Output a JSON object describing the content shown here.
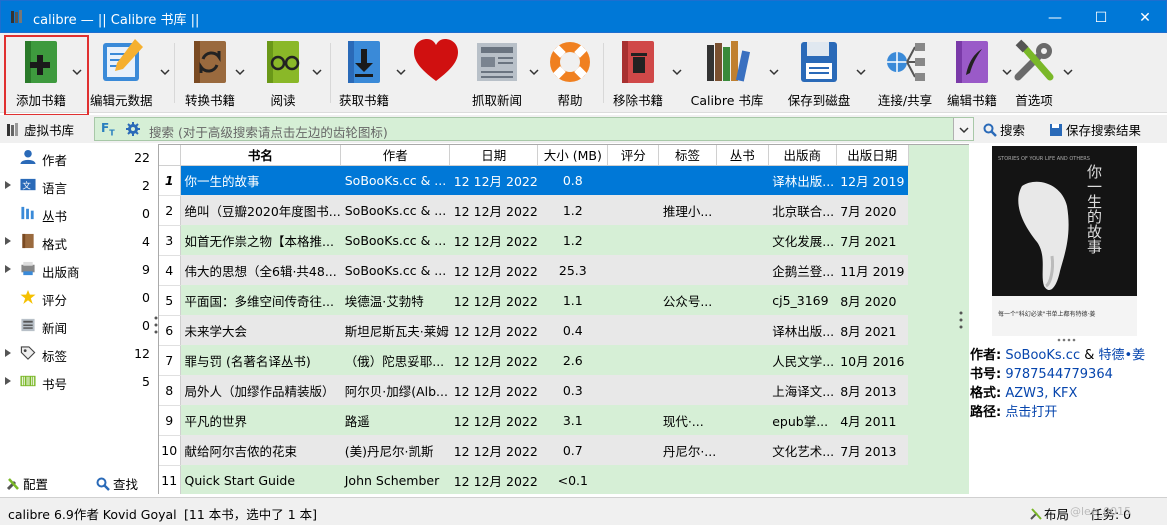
{
  "window": {
    "title": "calibre — || Calibre 书库 ||",
    "minimize": "—",
    "maximize": "☐",
    "close": "✕"
  },
  "toolbar": {
    "items": [
      {
        "label": "添加书籍",
        "icon": "add-book-icon"
      },
      {
        "label": "编辑元数据",
        "icon": "edit-metadata-icon"
      },
      {
        "label": "转换书籍",
        "icon": "convert-books-icon"
      },
      {
        "label": "阅读",
        "icon": "read-book-icon"
      },
      {
        "label": "获取书籍",
        "icon": "get-books-icon"
      },
      {
        "label": "",
        "icon": "heart-icon"
      },
      {
        "label": "抓取新闻",
        "icon": "fetch-news-icon"
      },
      {
        "label": "帮助",
        "icon": "help-lifebuoy-icon"
      },
      {
        "label": "移除书籍",
        "icon": "remove-books-icon"
      },
      {
        "label": "Calibre 书库",
        "icon": "library-icon"
      },
      {
        "label": "保存到磁盘",
        "icon": "save-disk-icon"
      },
      {
        "label": "连接/共享",
        "icon": "connect-share-icon"
      },
      {
        "label": "编辑书籍",
        "icon": "edit-book-icon"
      },
      {
        "label": "首选项",
        "icon": "preferences-icon"
      }
    ]
  },
  "search": {
    "virtual_library": "虚拟书库",
    "ft": "F",
    "placeholder": "搜索 (对于高级搜索请点击左边的齿轮图标)",
    "search_button": "搜索",
    "save_search_button": "保存搜索结果"
  },
  "tag_browser": {
    "items": [
      {
        "label": "作者",
        "count": "22",
        "icon": "author-icon",
        "expandable": false
      },
      {
        "label": "语言",
        "count": "2",
        "icon": "language-icon",
        "expandable": true
      },
      {
        "label": "丛书",
        "count": "0",
        "icon": "series-icon",
        "expandable": false
      },
      {
        "label": "格式",
        "count": "4",
        "icon": "format-icon",
        "expandable": true
      },
      {
        "label": "出版商",
        "count": "9",
        "icon": "publisher-icon",
        "expandable": true
      },
      {
        "label": "评分",
        "count": "0",
        "icon": "rating-star-icon",
        "expandable": false
      },
      {
        "label": "新闻",
        "count": "0",
        "icon": "news-icon",
        "expandable": false
      },
      {
        "label": "标签",
        "count": "12",
        "icon": "tag-icon",
        "expandable": true
      },
      {
        "label": "书号",
        "count": "5",
        "icon": "isbn-barcode-icon",
        "expandable": true
      }
    ],
    "configure": "配置",
    "find": "查找"
  },
  "table": {
    "columns": [
      "书名",
      "作者",
      "日期",
      "大小 (MB)",
      "评分",
      "标签",
      "丛书",
      "出版商",
      "出版日期"
    ],
    "rows": [
      {
        "num": "1",
        "title": "你一生的故事",
        "author": "SoBooKs.cc & ...",
        "date": "12 12月 2022",
        "size": "0.8",
        "rating": "",
        "tags": "",
        "series": "",
        "publisher": "译林出版...",
        "pubdate": "12月 2019"
      },
      {
        "num": "2",
        "title": "绝叫（豆瓣2020年度图书...",
        "author": "SoBooKs.cc & ...",
        "date": "12 12月 2022",
        "size": "1.2",
        "rating": "",
        "tags": "推理小...",
        "series": "",
        "publisher": "北京联合...",
        "pubdate": "7月 2020"
      },
      {
        "num": "3",
        "title": "如首无作祟之物【本格推...",
        "author": "SoBooKs.cc & ...",
        "date": "12 12月 2022",
        "size": "1.2",
        "rating": "",
        "tags": "",
        "series": "",
        "publisher": "文化发展...",
        "pubdate": "7月 2021"
      },
      {
        "num": "4",
        "title": "伟大的思想（全6辑·共48...",
        "author": "SoBooKs.cc & ...",
        "date": "12 12月 2022",
        "size": "25.3",
        "rating": "",
        "tags": "",
        "series": "",
        "publisher": "企鹅兰登...",
        "pubdate": "11月 2019"
      },
      {
        "num": "5",
        "title": "平面国：多维空间传奇往...",
        "author": "埃德温·艾勃特",
        "date": "12 12月 2022",
        "size": "1.1",
        "rating": "",
        "tags": "公众号...",
        "series": "",
        "publisher": "cj5_3169",
        "pubdate": "8月 2020"
      },
      {
        "num": "6",
        "title": "未来学大会",
        "author": "斯坦尼斯瓦夫·莱姆",
        "date": "12 12月 2022",
        "size": "0.4",
        "rating": "",
        "tags": "",
        "series": "",
        "publisher": "译林出版...",
        "pubdate": "8月 2021"
      },
      {
        "num": "7",
        "title": "罪与罚 (名著名译丛书)",
        "author": "（俄）陀思妥耶...",
        "date": "12 12月 2022",
        "size": "2.6",
        "rating": "",
        "tags": "",
        "series": "",
        "publisher": "人民文学...",
        "pubdate": "10月 2016"
      },
      {
        "num": "8",
        "title": "局外人（加缪作品精装版）",
        "author": "阿尔贝·加缪(Alb...",
        "date": "12 12月 2022",
        "size": "0.3",
        "rating": "",
        "tags": "",
        "series": "",
        "publisher": "上海译文...",
        "pubdate": "8月 2013"
      },
      {
        "num": "9",
        "title": "平凡的世界",
        "author": "路遥",
        "date": "12 12月 2022",
        "size": "3.1",
        "rating": "",
        "tags": "现代·...",
        "series": "",
        "publisher": "epub掌...",
        "pubdate": "4月 2011"
      },
      {
        "num": "10",
        "title": "献给阿尔吉侬的花束",
        "author": "(美)丹尼尔·凯斯",
        "date": "12 12月 2022",
        "size": "0.7",
        "rating": "",
        "tags": "丹尼尔·...",
        "series": "",
        "publisher": "文化艺术...",
        "pubdate": "7月 2013"
      },
      {
        "num": "11",
        "title": "Quick Start Guide",
        "author": "John Schember",
        "date": "12 12月 2022",
        "size": "<0.1",
        "rating": "",
        "tags": "",
        "series": "",
        "publisher": "",
        "pubdate": ""
      }
    ]
  },
  "cover": {
    "title_cn": "你一生的故事",
    "title_en": "STORIES OF YOUR LIFE AND OTHERS",
    "blurb": "每一个\"科幻必读\"书单上都有特德·姜"
  },
  "details": {
    "author_key": "作者:",
    "author_val1": "SoBooKs.cc",
    "author_amp": " & ",
    "author_val2": "特德•姜",
    "isbn_key": "书号:",
    "isbn_val": "9787544779364",
    "format_key": "格式:",
    "format_val": "AZW3, KFX",
    "path_key": "路径:",
    "path_val": "点击打开"
  },
  "status": {
    "version": "calibre 6.9作者 Kovid Goyal",
    "count": "[11 本书，选中了 1 本]",
    "layout": "布局",
    "jobs": "任务: 0",
    "watermark": "@lee_0015"
  }
}
